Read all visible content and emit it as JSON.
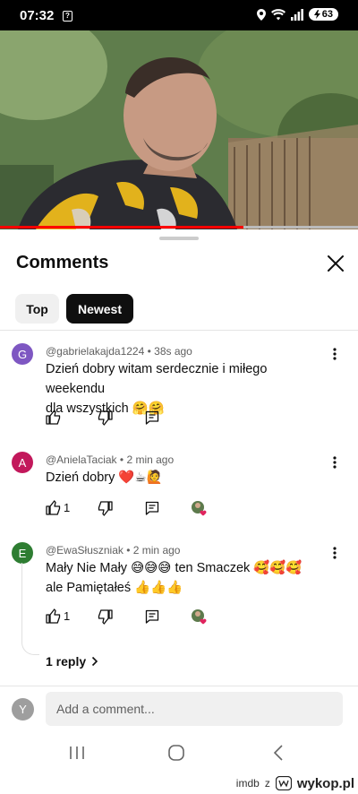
{
  "status_bar": {
    "time": "07:32",
    "notification_glyph": "?",
    "battery": "63",
    "icons": [
      "location-icon",
      "wifi-icon",
      "signal-icon",
      "battery-charging-icon"
    ]
  },
  "video": {
    "progress_fraction": 0.68,
    "accent_color": "#ff0000"
  },
  "comments_panel": {
    "title": "Comments",
    "close_icon": "close-icon",
    "filters": [
      {
        "label": "Top",
        "selected": false
      },
      {
        "label": "Newest",
        "selected": true
      }
    ]
  },
  "comments": [
    {
      "avatar_letter": "G",
      "avatar_color": "#7e57c2",
      "author": "@gabrielakajda1224",
      "time": "38s ago",
      "text_line1": "Dzień dobry witam serdecznie i miłego weekendu",
      "text_line2": "dla wszystkich 🤗🤗",
      "likes": ""
    },
    {
      "avatar_letter": "A",
      "avatar_color": "#c2185b",
      "author": "@AnielaTaciak",
      "time": "2 min ago",
      "text_line1": "Dzień dobry ❤️☕🙋",
      "likes": "1",
      "creator_heart": true
    },
    {
      "avatar_letter": "E",
      "avatar_color": "#2e7d32",
      "author": "@EwaSłuszniak",
      "time": "2 min ago",
      "text_line1": "Mały Nie Mały 😅😅😅 ten Smaczek 🥰🥰🥰",
      "text_line2": "ale Pamiętałeś 👍👍👍",
      "likes": "1",
      "creator_heart": true,
      "replies_label": "1 reply"
    }
  ],
  "composer": {
    "avatar_letter": "Y",
    "placeholder": "Add a comment..."
  },
  "watermark": {
    "imdb": "imdb",
    "z": "z",
    "site": "wykop.pl"
  }
}
